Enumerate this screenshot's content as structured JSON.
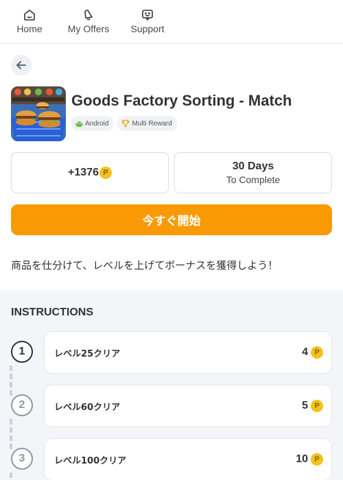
{
  "nav": {
    "items": [
      {
        "label": "Home",
        "icon": "home-icon"
      },
      {
        "label": "My Offers",
        "icon": "bell-icon"
      },
      {
        "label": "Support",
        "icon": "chat-icon"
      }
    ]
  },
  "offer": {
    "title": "Goods Factory Sorting - Match",
    "tags": [
      {
        "label": "Android",
        "icon": "android-icon"
      },
      {
        "label": "Multi Reward",
        "icon": "trophy-icon"
      }
    ],
    "reward": "+1376",
    "coin_symbol": "P",
    "days_title": "30 Days",
    "days_sub": "To Complete",
    "start_label": "今すぐ開始",
    "description": "商品を仕分けて、レベルを上げてボーナスを獲得しよう！"
  },
  "instructions": {
    "title": "INSTRUCTIONS",
    "steps": [
      {
        "num": "1",
        "label": "レベル25クリア",
        "reward": "4"
      },
      {
        "num": "2",
        "label": "レベル60クリア",
        "reward": "5"
      },
      {
        "num": "3",
        "label": "レベル100クリア",
        "reward": "10"
      }
    ]
  },
  "colors": {
    "accent": "#f99a05",
    "coin": "#f2c21b",
    "section_bg": "#f3f5f8"
  }
}
